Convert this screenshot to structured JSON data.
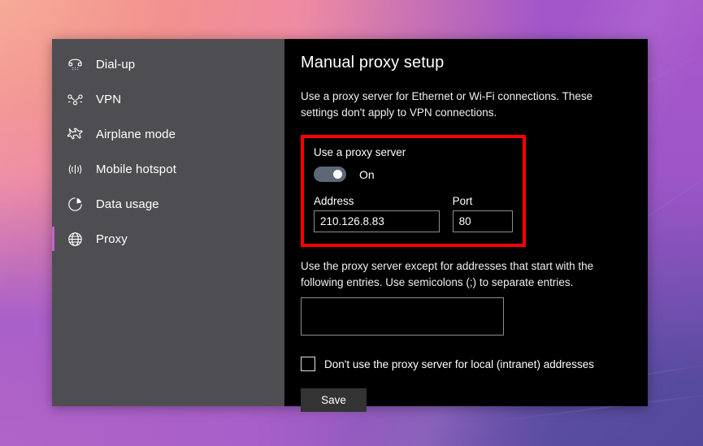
{
  "window": {
    "sidebar": {
      "items": [
        {
          "label": "Dial-up",
          "icon": "dial-up-phone-icon",
          "selected": false
        },
        {
          "label": "VPN",
          "icon": "vpn-key-icon",
          "selected": false
        },
        {
          "label": "Airplane mode",
          "icon": "airplane-icon",
          "selected": false
        },
        {
          "label": "Mobile hotspot",
          "icon": "mobile-hotspot-icon",
          "selected": false
        },
        {
          "label": "Data usage",
          "icon": "pie-chart-icon",
          "selected": false
        },
        {
          "label": "Proxy",
          "icon": "globe-icon",
          "selected": true
        }
      ]
    },
    "main": {
      "title": "Manual proxy setup",
      "description": "Use a proxy server for Ethernet or Wi-Fi connections. These settings don't apply to VPN connections.",
      "proxy_group": {
        "label": "Use a proxy server",
        "toggle_state": "On",
        "address": {
          "caption": "Address",
          "value": "210.126.8.83",
          "placeholder": ""
        },
        "port": {
          "caption": "Port",
          "value": "80",
          "placeholder": ""
        }
      },
      "exceptions": {
        "description": "Use the proxy server except for addresses that start with the following entries. Use semicolons (;) to separate entries.",
        "value": "",
        "placeholder": ""
      },
      "bypass_local": {
        "label": "Don't use the proxy server for local (intranet) addresses",
        "checked": false
      },
      "save_label": "Save"
    }
  },
  "colors": {
    "highlight_box": "#ff0000",
    "accent_selected": "#c462c9",
    "toggle_on_track": "#5e6775",
    "sidebar_bg": "#4e4e52",
    "panel_bg": "#000000",
    "save_button_bg": "#333333"
  }
}
